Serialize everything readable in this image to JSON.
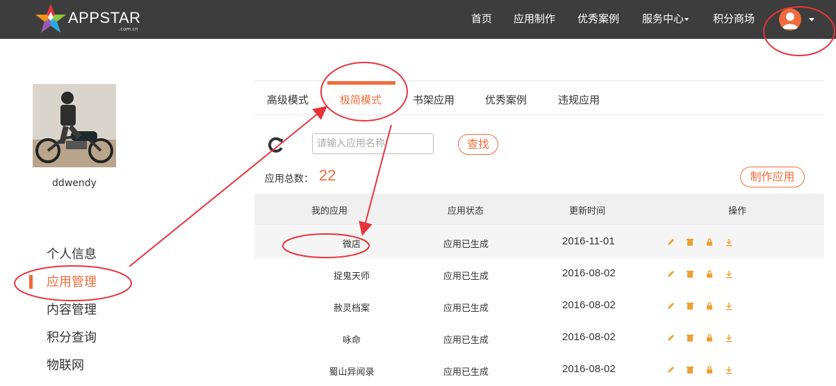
{
  "header": {
    "brand": "APPSTAR",
    "brand_sub": ".com.cn",
    "nav": [
      "首页",
      "应用制作",
      "优秀案例",
      "服务中心",
      "积分商场"
    ]
  },
  "profile": {
    "username": "ddwendy"
  },
  "sidebar": {
    "items": [
      {
        "label": "个人信息"
      },
      {
        "label": "应用管理",
        "active": true
      },
      {
        "label": "内容管理"
      },
      {
        "label": "积分查询"
      },
      {
        "label": "物联网"
      }
    ]
  },
  "tabs": [
    {
      "label": "高级模式"
    },
    {
      "label": "极简模式",
      "active": true
    },
    {
      "label": "书架应用"
    },
    {
      "label": "优秀案例"
    },
    {
      "label": "违规应用"
    }
  ],
  "search": {
    "placeholder": "请输入应用名称",
    "value": "",
    "button": "查找"
  },
  "summary": {
    "label": "应用总数：",
    "count": "22",
    "create_button": "制作应用"
  },
  "table": {
    "columns": [
      "我的应用",
      "应用状态",
      "更新时间",
      "操作"
    ],
    "rows": [
      {
        "name": "微店",
        "status": "应用已生成",
        "updated": "2016-11-01"
      },
      {
        "name": "捉鬼天师",
        "status": "应用已生成",
        "updated": "2016-08-02"
      },
      {
        "name": "赦灵档案",
        "status": "应用已生成",
        "updated": "2016-08-02"
      },
      {
        "name": "咏命",
        "status": "应用已生成",
        "updated": "2016-08-02"
      },
      {
        "name": "蜀山异闻录",
        "status": "应用已生成",
        "updated": "2016-08-02"
      }
    ],
    "action_icons": [
      "edit-icon",
      "delete-icon",
      "lock-icon",
      "download-icon"
    ]
  },
  "colors": {
    "accent": "#f26b3a",
    "header_bg": "#3d3d3d",
    "annotation": "#e8333a"
  }
}
